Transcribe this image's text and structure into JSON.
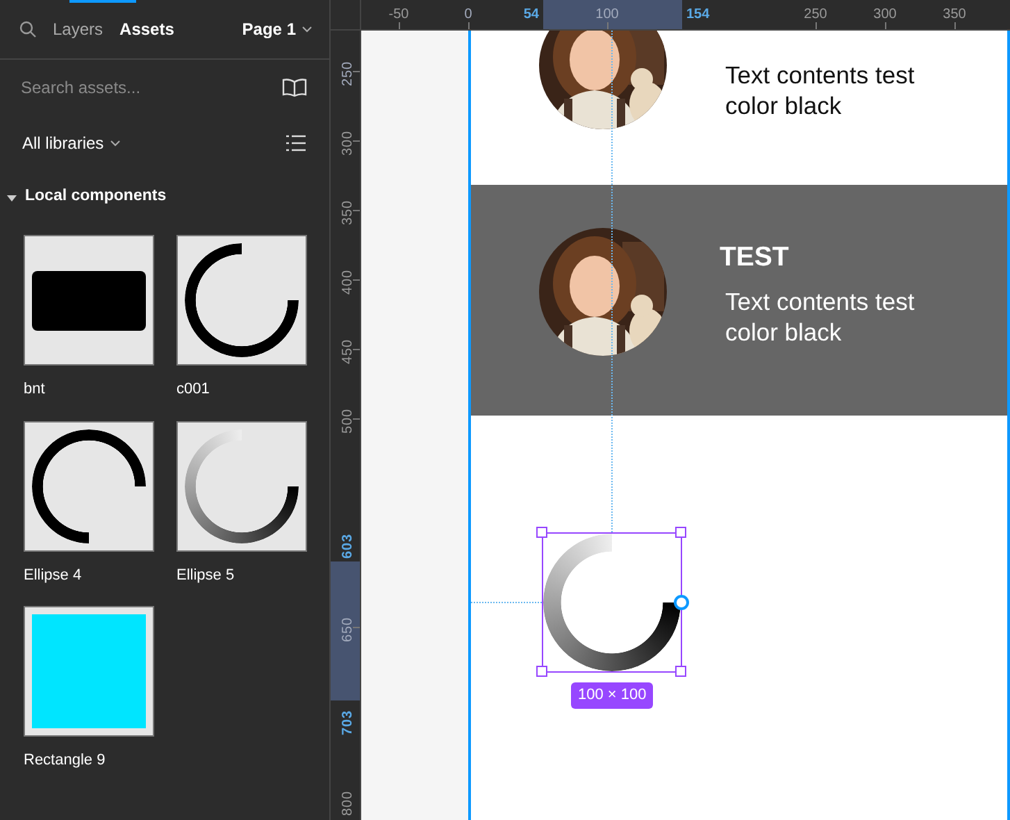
{
  "sidebar": {
    "tabs": [
      {
        "label": "Layers",
        "selected": false
      },
      {
        "label": "Assets",
        "selected": true
      }
    ],
    "page": "Page 1",
    "search": {
      "placeholder": "Search assets..."
    },
    "library_filter": "All libraries",
    "section": {
      "title": "Local components",
      "expanded": true
    },
    "components": [
      {
        "name": "bnt",
        "kind": "button"
      },
      {
        "name": "c001",
        "kind": "ring"
      },
      {
        "name": "Ellipse 4",
        "kind": "arc"
      },
      {
        "name": "Ellipse 5",
        "kind": "gradient-ring"
      },
      {
        "name": "Rectangle 9",
        "kind": "rectangle",
        "color": "#00e5ff"
      }
    ]
  },
  "rulers": {
    "top": [
      {
        "label": "-50",
        "kind": "tick"
      },
      {
        "label": "0",
        "kind": "faint"
      },
      {
        "label": "54",
        "kind": "start"
      },
      {
        "label": "100",
        "kind": "faint"
      },
      {
        "label": "154",
        "kind": "end"
      },
      {
        "label": "250",
        "kind": "tick"
      },
      {
        "label": "300",
        "kind": "tick"
      },
      {
        "label": "350",
        "kind": "tick"
      }
    ],
    "left": [
      {
        "label": "250",
        "kind": "faint"
      },
      {
        "label": "300",
        "kind": "tick"
      },
      {
        "label": "350",
        "kind": "tick"
      },
      {
        "label": "400",
        "kind": "tick"
      },
      {
        "label": "450",
        "kind": "tick"
      },
      {
        "label": "500",
        "kind": "tick"
      },
      {
        "label": "603",
        "kind": "start"
      },
      {
        "label": "650",
        "kind": "faint"
      },
      {
        "label": "703",
        "kind": "end"
      },
      {
        "label": "800",
        "kind": "tick"
      }
    ]
  },
  "canvas": {
    "cards": [
      {
        "kind": "light",
        "body": "Text contents test color black"
      },
      {
        "kind": "dark",
        "title": "TEST",
        "body": "Text contents test color black"
      }
    ],
    "selection": {
      "size": "100 × 100"
    }
  }
}
